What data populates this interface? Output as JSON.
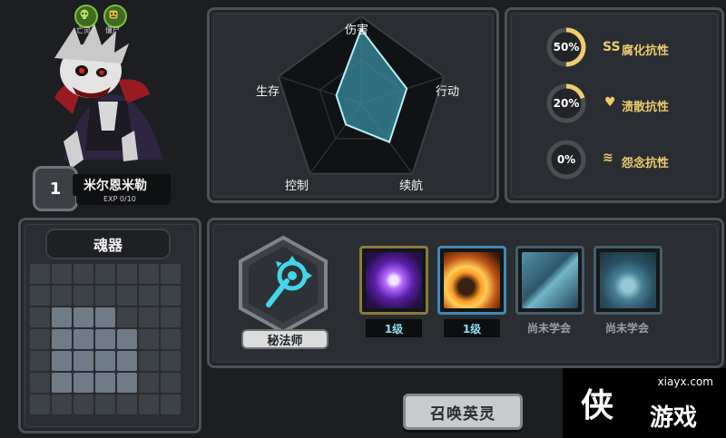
{
  "tags": [
    {
      "label": "亡灵",
      "icon": "skull-icon"
    },
    {
      "label": "僵尸",
      "icon": "zombie-icon"
    }
  ],
  "hero": {
    "level": "1",
    "name": "米尔恩米勒",
    "exp": "EXP 0/10",
    "icon": "vampire-portrait"
  },
  "soul": {
    "title": "魂器",
    "grid_rows": [
      [
        0,
        0,
        0,
        0,
        0,
        0,
        0
      ],
      [
        0,
        0,
        0,
        0,
        0,
        0,
        0
      ],
      [
        0,
        1,
        1,
        1,
        0,
        0,
        0
      ],
      [
        0,
        1,
        1,
        1,
        1,
        0,
        0
      ],
      [
        0,
        1,
        1,
        1,
        1,
        0,
        0
      ],
      [
        0,
        1,
        1,
        1,
        1,
        0,
        0
      ],
      [
        0,
        0,
        0,
        0,
        0,
        0,
        0
      ]
    ]
  },
  "radar": {
    "labels": [
      "伤害",
      "行动",
      "续航",
      "控制",
      "生存"
    ],
    "values": [
      0.85,
      0.55,
      0.55,
      0.3,
      0.3
    ],
    "fill_color": "#3a8fa0",
    "stroke_color": "#b9f0f7"
  },
  "resistances": [
    {
      "value": "50%",
      "fraction": 0.5,
      "icon": "SS",
      "label": "腐化抗性"
    },
    {
      "value": "20%",
      "fraction": 0.2,
      "icon": "♥",
      "label": "溃散抗性"
    },
    {
      "value": "0%",
      "fraction": 0.0,
      "icon": "≋",
      "label": "怨念抗性"
    }
  ],
  "hero_class": {
    "label": "秘法师",
    "icon": "arcane-staff-icon"
  },
  "skills": [
    {
      "level": "1级",
      "icon": "purple-orb-icon",
      "learned": true
    },
    {
      "level": "1级",
      "icon": "fireball-icon",
      "learned": true
    },
    {
      "status": "尚未学会",
      "icon": "ice-spike-icon",
      "learned": false
    },
    {
      "status": "尚未学会",
      "icon": "frost-creature-icon",
      "learned": false
    }
  ],
  "summon_button": "召唤英灵",
  "watermark": {
    "url": "xiayx.com",
    "logo": "侠",
    "text": "游戏"
  },
  "colors": {
    "accent_gold": "#f0cc6e",
    "ring_track": "#444",
    "panel": "#2a2d31"
  }
}
